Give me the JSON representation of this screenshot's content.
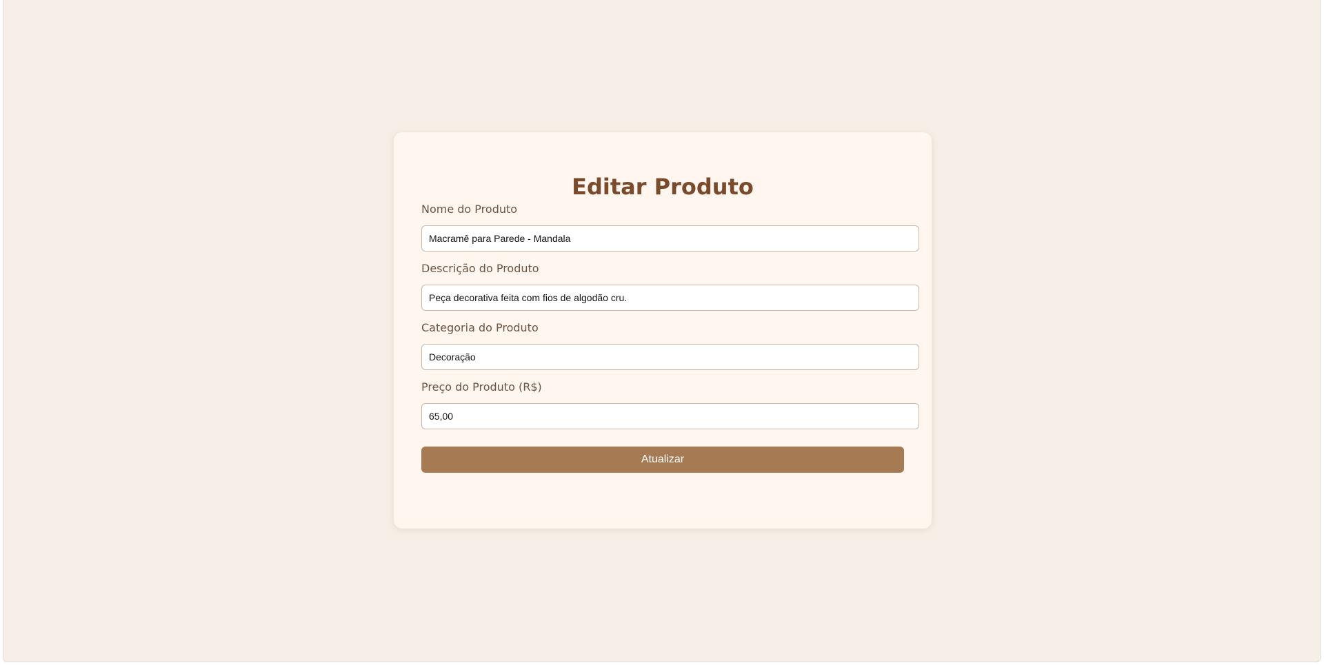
{
  "form": {
    "title": "Editar Produto",
    "fields": [
      {
        "label": "Nome do Produto",
        "value": "Macramê para Parede - Mandala"
      },
      {
        "label": "Descrição do Produto",
        "value": "Peça decorativa feita com fios de algodão cru."
      },
      {
        "label": "Categoria do Produto",
        "value": "Decoração"
      },
      {
        "label": "Preço do Produto (R$)",
        "value": "65,00"
      }
    ],
    "submit_label": "Atualizar"
  },
  "colors": {
    "page_background": "#f5efe7",
    "card_background": "#fef6ef",
    "title": "#7a4a2c",
    "label": "#6b5443",
    "button": "#a67b54",
    "input_border": "#c9b7a6"
  }
}
